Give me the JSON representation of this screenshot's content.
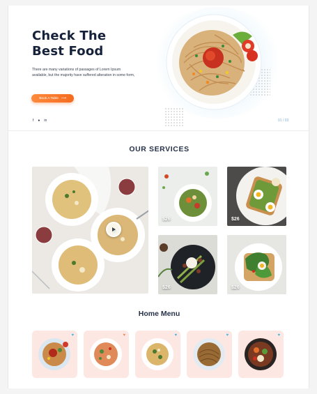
{
  "hero": {
    "title_line1": "Check The",
    "title_line2": "Best Food",
    "description": "There are many variations of passages of Lorem Ipsum available, but the majority have suffered alteration in some form,",
    "cta_label": "Book A Table",
    "cta_arrow": "⟶",
    "social": [
      "f",
      "●",
      "in"
    ],
    "pager": "01 / 03"
  },
  "services": {
    "title": "OUR SERVICES",
    "prices": [
      "$26",
      "$26",
      "$26",
      "$26"
    ]
  },
  "home_menu": {
    "title": "Home Menu",
    "cards": [
      {
        "heart_color": "#3fb6e3"
      },
      {
        "heart_color": "#f08a5d"
      },
      {
        "heart_color": "#3fb6e3"
      },
      {
        "heart_color": "#3fb6e3"
      },
      {
        "heart_color": "#3fb6e3"
      }
    ]
  },
  "colors": {
    "accent": "#f46b1e",
    "heading": "#16213a",
    "menu_card_bg": "#fde7e3"
  },
  "icons": [
    "play-icon",
    "heart-icon",
    "facebook-icon",
    "instagram-icon",
    "linkedin-icon",
    "arrow-right-icon"
  ]
}
